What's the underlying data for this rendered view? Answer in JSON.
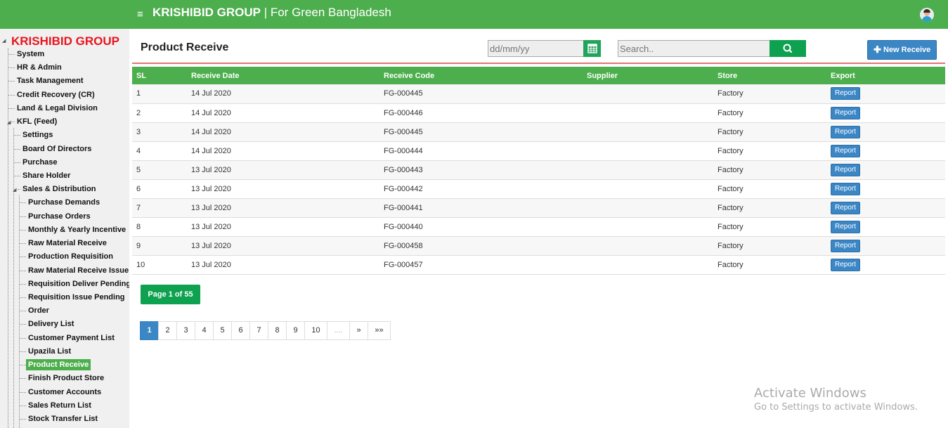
{
  "header": {
    "brand": "KRISHIBID GROUP",
    "separator": " | ",
    "tagline": "For Green Bangladesh",
    "menu_icon": "hamburger-icon",
    "accent_color": "#4cae4c"
  },
  "sidebar": {
    "brand": "KRISHIBID GROUP",
    "brand_color": "#e8151f",
    "items": [
      {
        "label": "System"
      },
      {
        "label": "HR & Admin"
      },
      {
        "label": "Task Management"
      },
      {
        "label": "Credit Recovery (CR)"
      },
      {
        "label": "Land & Legal Division"
      },
      {
        "label": "KFL (Feed)"
      },
      {
        "label": "Settings"
      },
      {
        "label": "Board Of Directors"
      },
      {
        "label": "Purchase"
      },
      {
        "label": "Share Holder"
      },
      {
        "label": "Sales & Distribution"
      },
      {
        "label": "Purchase Demands"
      },
      {
        "label": "Purchase Orders"
      },
      {
        "label": "Monthly & Yearly Incentive"
      },
      {
        "label": "Raw Material Receive"
      },
      {
        "label": "Production Requisition"
      },
      {
        "label": "Raw Material Receive Issue"
      },
      {
        "label": "Requisition Deliver Pending"
      },
      {
        "label": "Requisition Issue Pending"
      },
      {
        "label": "Order"
      },
      {
        "label": "Delivery List"
      },
      {
        "label": "Customer Payment List"
      },
      {
        "label": "Upazila List"
      },
      {
        "label": "Product Receive"
      },
      {
        "label": "Finish Product Store"
      },
      {
        "label": "Customer Accounts"
      },
      {
        "label": "Sales Return List"
      },
      {
        "label": "Stock Transfer List"
      }
    ],
    "active_item": "Product Receive"
  },
  "main": {
    "title": "Product Receive",
    "date_placeholder": "dd/mm/yy",
    "search_placeholder": "Search..",
    "new_button": "New Receive",
    "table": {
      "columns": [
        "SL",
        "Receive Date",
        "Receive Code",
        "Supplier",
        "Store",
        "Export"
      ],
      "rows": [
        {
          "sl": "1",
          "date": "14 Jul 2020",
          "code": "FG-000445",
          "supplier": "",
          "store": "Factory",
          "export": "Report"
        },
        {
          "sl": "2",
          "date": "14 Jul 2020",
          "code": "FG-000446",
          "supplier": "",
          "store": "Factory",
          "export": "Report"
        },
        {
          "sl": "3",
          "date": "14 Jul 2020",
          "code": "FG-000445",
          "supplier": "",
          "store": "Factory",
          "export": "Report"
        },
        {
          "sl": "4",
          "date": "14 Jul 2020",
          "code": "FG-000444",
          "supplier": "",
          "store": "Factory",
          "export": "Report"
        },
        {
          "sl": "5",
          "date": "13 Jul 2020",
          "code": "FG-000443",
          "supplier": "",
          "store": "Factory",
          "export": "Report"
        },
        {
          "sl": "6",
          "date": "13 Jul 2020",
          "code": "FG-000442",
          "supplier": "",
          "store": "Factory",
          "export": "Report"
        },
        {
          "sl": "7",
          "date": "13 Jul 2020",
          "code": "FG-000441",
          "supplier": "",
          "store": "Factory",
          "export": "Report"
        },
        {
          "sl": "8",
          "date": "13 Jul 2020",
          "code": "FG-000440",
          "supplier": "",
          "store": "Factory",
          "export": "Report"
        },
        {
          "sl": "9",
          "date": "13 Jul 2020",
          "code": "FG-000458",
          "supplier": "",
          "store": "Factory",
          "export": "Report"
        },
        {
          "sl": "10",
          "date": "13 Jul 2020",
          "code": "FG-000457",
          "supplier": "",
          "store": "Factory",
          "export": "Report"
        }
      ]
    },
    "page_info": "Page 1 of 55",
    "pagination": [
      "1",
      "2",
      "3",
      "4",
      "5",
      "6",
      "7",
      "8",
      "9",
      "10",
      "....",
      "»",
      "»»"
    ],
    "current_page": "1"
  },
  "watermark": {
    "line1": "Activate Windows",
    "line2": "Go to Settings to activate Windows."
  }
}
